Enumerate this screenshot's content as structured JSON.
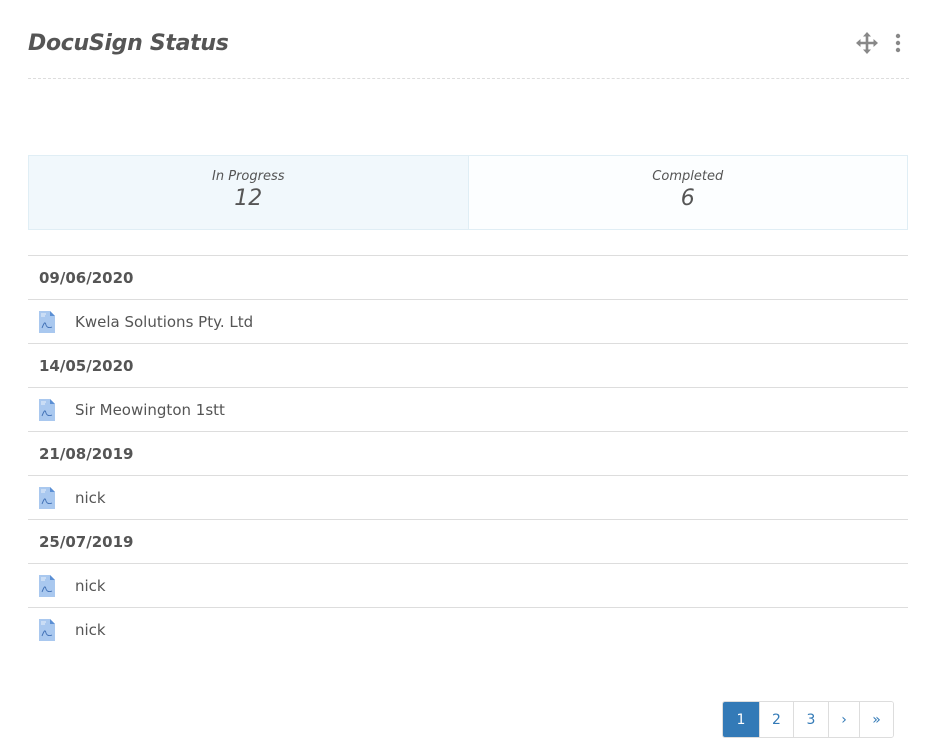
{
  "header": {
    "title": "DocuSign Status"
  },
  "stats": {
    "in_progress": {
      "label": "In Progress",
      "value": "12"
    },
    "completed": {
      "label": "Completed",
      "value": "6"
    }
  },
  "list": {
    "groups": [
      {
        "date": "09/06/2020",
        "docs": [
          "Kwela Solutions Pty. Ltd"
        ]
      },
      {
        "date": "14/05/2020",
        "docs": [
          "Sir Meowington 1stt"
        ]
      },
      {
        "date": "21/08/2019",
        "docs": [
          "nick"
        ]
      },
      {
        "date": "25/07/2019",
        "docs": [
          "nick",
          "nick"
        ]
      }
    ]
  },
  "pagination": {
    "pages": [
      "1",
      "2",
      "3"
    ],
    "next": "›",
    "last": "»",
    "current": "1"
  },
  "colors": {
    "accent": "#337ab7",
    "pdf_icon": "#a9c8ef"
  }
}
